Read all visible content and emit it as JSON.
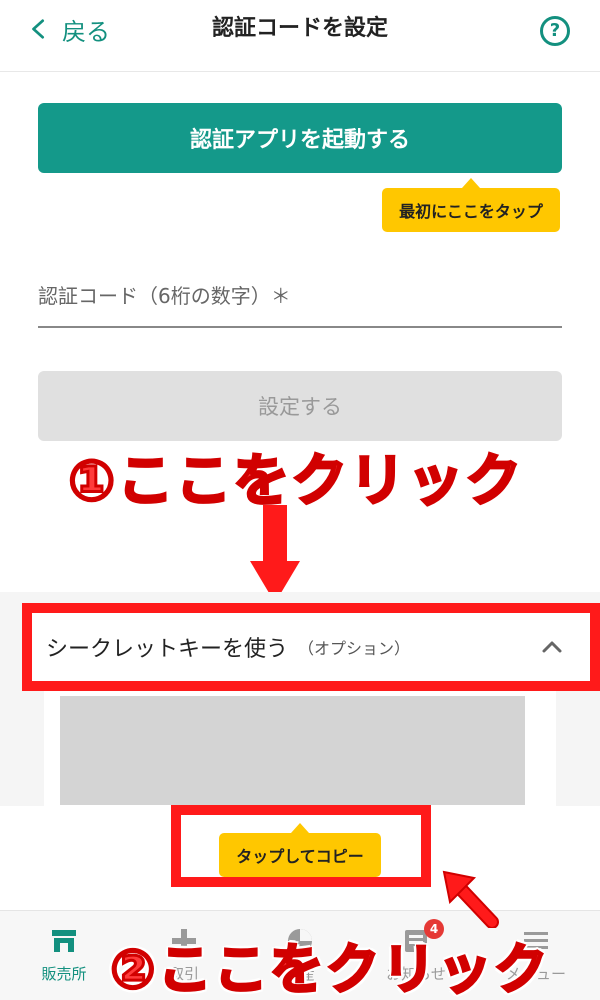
{
  "header": {
    "back_label": "戻る",
    "title": "認証コードを設定",
    "help_label": "?"
  },
  "launch_button": {
    "label": "認証アプリを起動する"
  },
  "tip_first": {
    "label": "最初にここをタップ"
  },
  "code_field": {
    "placeholder": "認証コード（6桁の数字）＊"
  },
  "set_button": {
    "label": "設定する"
  },
  "annotations": {
    "step1": "①ここをクリック",
    "step2": "②ここをクリック"
  },
  "secret_section": {
    "title": "シークレットキーを使う",
    "subtitle": "（オプション）"
  },
  "tip_copy": {
    "label": "タップしてコピー"
  },
  "bottom_nav": {
    "items": [
      {
        "label": "販売所",
        "icon": "store-icon",
        "active": true
      },
      {
        "label": "取引",
        "icon": "plus-icon"
      },
      {
        "label": "資産",
        "icon": "pie-chart-icon"
      },
      {
        "label": "お知らせ",
        "icon": "news-icon",
        "badge": "4"
      },
      {
        "label": "メニュー",
        "icon": "menu-icon"
      }
    ]
  },
  "colors": {
    "primary": "#14998a",
    "tooltip": "#ffc700",
    "annotation_red": "#ff1a1a",
    "disabled": "#e0e0e0"
  }
}
